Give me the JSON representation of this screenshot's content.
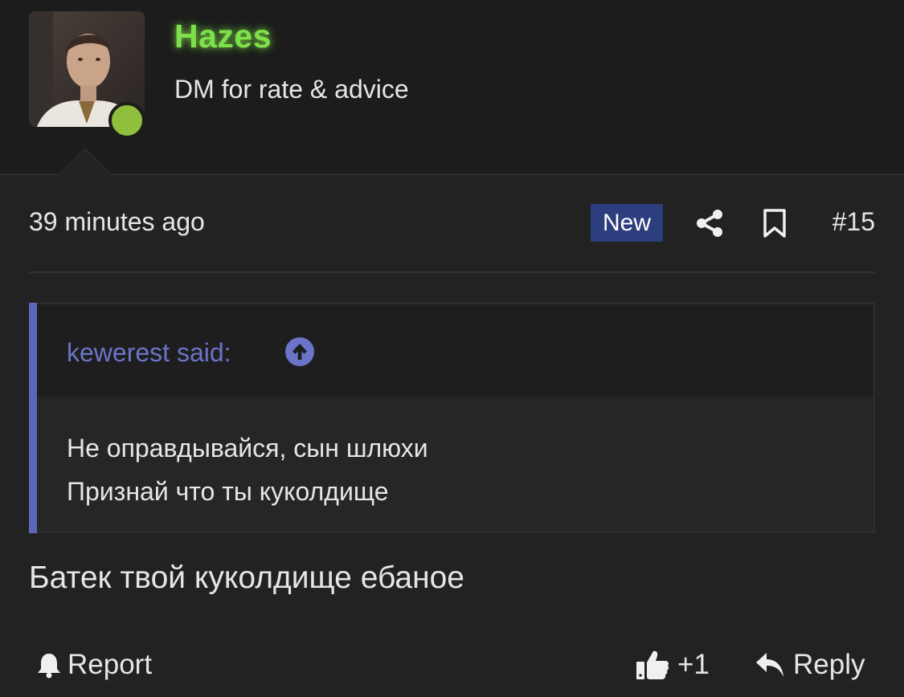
{
  "user": {
    "name": "Hazes",
    "title": "DM for rate & advice",
    "status": "online",
    "name_color": "#7ee04a",
    "status_color": "#8fbf3c"
  },
  "post": {
    "timestamp": "39 minutes ago",
    "badge": "New",
    "number": "#15",
    "body": "Батек твой куколдище ебаное"
  },
  "quote": {
    "author_label": "kewerest said:",
    "lines": [
      "Не оправдывайся, сын шлюхи",
      "Признай что ты куколдище"
    ]
  },
  "actions": {
    "report": "Report",
    "like_count": "+1",
    "reply": "Reply"
  },
  "icons": {
    "share": "share-icon",
    "bookmark": "bookmark-icon",
    "quote_jump": "arrow-up-circle-icon",
    "report": "bell-icon",
    "like": "thumbs-up-icon",
    "reply": "reply-icon"
  },
  "colors": {
    "background": "#222222",
    "header_background": "#1c1c1c",
    "badge_background": "#2c3e7e",
    "quote_accent": "#5e66b8"
  }
}
